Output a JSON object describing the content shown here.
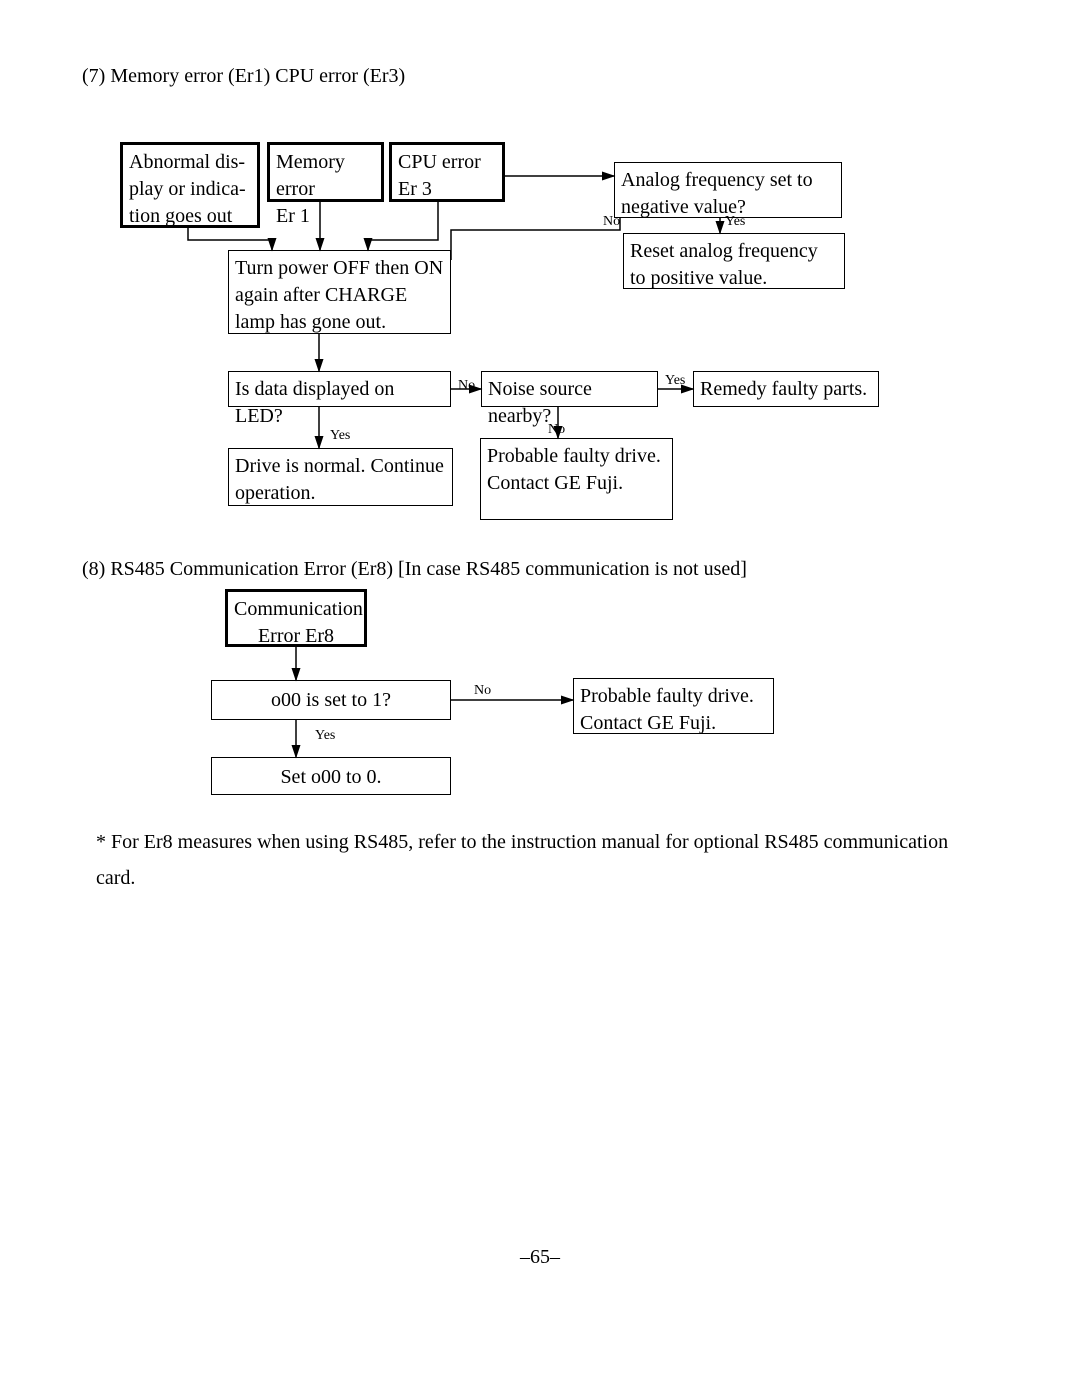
{
  "section7": {
    "title": "(7) Memory error (Er1)  CPU error (Er3)",
    "boxes": {
      "abnormal": "Abnormal dis-\nplay or indica-\ntion goes out",
      "memErr": "Memory error\nEr 1",
      "cpuErr": "CPU error\nEr 3",
      "analogQ": "Analog frequency set to negative value?",
      "resetAnalog": "Reset analog frequency to positive value.",
      "powerOff": "Turn power OFF then ON again after CHARGE lamp has gone out.",
      "dataLed": "Is data displayed on LED?",
      "noiseQ": "Noise source nearby?",
      "remedy": "Remedy faulty parts.",
      "driveNormal": "Drive is normal.  Continue operation.",
      "faultyDrive": "Probable faulty drive. Contact GE Fuji."
    },
    "labels": {
      "no1": "No",
      "yes1": "Yes",
      "no2": "No",
      "yes2": "Yes",
      "yes3": "Yes",
      "no3": "No"
    }
  },
  "section8": {
    "title": "(8) RS485 Communication Error (Er8) [In case RS485 communication is not used]",
    "boxes": {
      "commErr": "Communication Error  Er8",
      "o00set": "o00 is set to 1?",
      "setO00": "Set o00 to 0.",
      "faultyDrive": "Probable faulty drive. Contact GE Fuji."
    },
    "labels": {
      "no": "No",
      "yes": "Yes"
    }
  },
  "footnote": "* For Er8 measures when using RS485, refer to the instruction manual for optional RS485 communication card.",
  "pageNumber": "–65–"
}
